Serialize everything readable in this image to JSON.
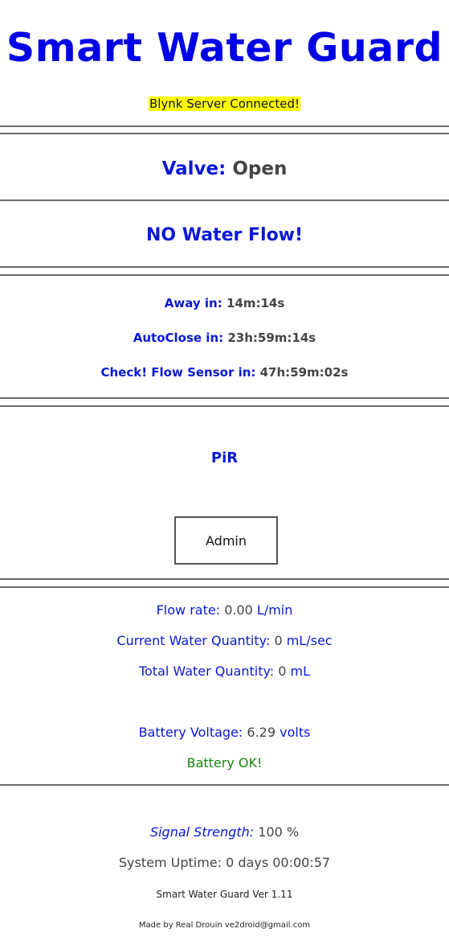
{
  "header": {
    "title": "Smart Water Guard",
    "connection_status": "Blynk Server Connected!"
  },
  "valve": {
    "label": "Valve:",
    "state": "Open"
  },
  "flow_status": "NO Water Flow!",
  "timers": [
    {
      "label": "Away in:",
      "value": "14m:14s"
    },
    {
      "label": "AutoClose in:",
      "value": "23h:59m:14s"
    },
    {
      "label": "Check! Flow Sensor in:",
      "value": "47h:59m:02s"
    }
  ],
  "pir": {
    "label": "PiR"
  },
  "admin_button": {
    "label": "Admin"
  },
  "measurements": {
    "flow_rate": {
      "label": "Flow rate:",
      "value": "0.00",
      "unit": "L/min"
    },
    "current_quantity": {
      "label": "Current Water Quantity:",
      "value": "0",
      "unit": "mL/sec"
    },
    "total_quantity": {
      "label": "Total Water Quantity:",
      "value": "0",
      "unit": "mL"
    },
    "battery_voltage": {
      "label": "Battery Voltage:",
      "value": "6.29",
      "unit": "volts"
    },
    "battery_status": "Battery OK!"
  },
  "system": {
    "signal": {
      "label": "Signal Strength:",
      "value": "100 %"
    },
    "uptime": {
      "label": "System Uptime:",
      "value": "0 days 00:00:57"
    },
    "version": "Smart Water Guard Ver 1.11",
    "credits": "Made by Real Drouin ve2droid@gmail.com"
  },
  "colors": {
    "title_blue": "#0000e6",
    "label_blue": "#0a18d8",
    "highlight_yellow": "#ffff00",
    "ok_green": "#118811"
  }
}
